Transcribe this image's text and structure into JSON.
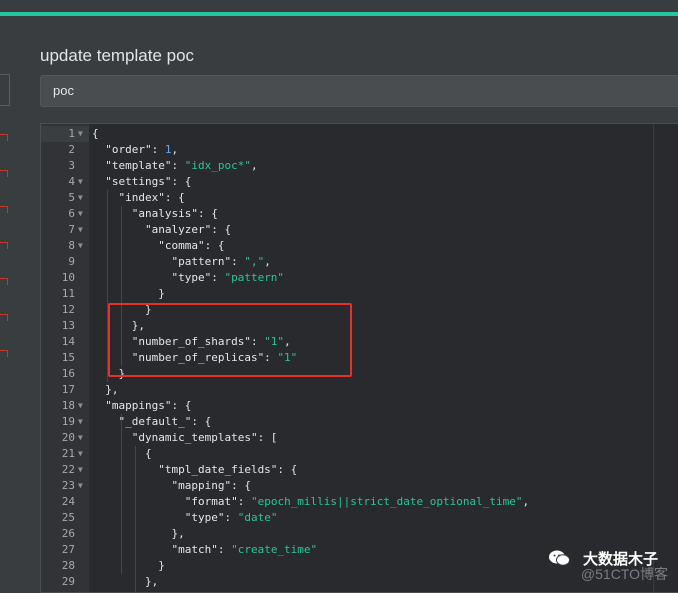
{
  "page": {
    "title": "update template poc",
    "name_field_value": "poc"
  },
  "editor": {
    "lines": [
      {
        "n": "1",
        "fold": true,
        "parts": [
          {
            "t": "{",
            "c": "k"
          }
        ]
      },
      {
        "n": "2",
        "fold": false,
        "parts": [
          {
            "t": "  \"order\": ",
            "c": "k"
          },
          {
            "t": "1",
            "c": "n"
          },
          {
            "t": ",",
            "c": "k"
          }
        ]
      },
      {
        "n": "3",
        "fold": false,
        "parts": [
          {
            "t": "  \"template\": ",
            "c": "k"
          },
          {
            "t": "\"idx_poc*\"",
            "c": "s"
          },
          {
            "t": ",",
            "c": "k"
          }
        ]
      },
      {
        "n": "4",
        "fold": true,
        "parts": [
          {
            "t": "  \"settings\": {",
            "c": "k"
          }
        ]
      },
      {
        "n": "5",
        "fold": true,
        "parts": [
          {
            "t": "    \"index\": {",
            "c": "k"
          }
        ]
      },
      {
        "n": "6",
        "fold": true,
        "parts": [
          {
            "t": "      \"analysis\": {",
            "c": "k"
          }
        ]
      },
      {
        "n": "7",
        "fold": true,
        "parts": [
          {
            "t": "        \"analyzer\": {",
            "c": "k"
          }
        ]
      },
      {
        "n": "8",
        "fold": true,
        "parts": [
          {
            "t": "          \"comma\": {",
            "c": "k"
          }
        ]
      },
      {
        "n": "9",
        "fold": false,
        "parts": [
          {
            "t": "            \"pattern\": ",
            "c": "k"
          },
          {
            "t": "\",\"",
            "c": "s"
          },
          {
            "t": ",",
            "c": "k"
          }
        ]
      },
      {
        "n": "10",
        "fold": false,
        "parts": [
          {
            "t": "            \"type\": ",
            "c": "k"
          },
          {
            "t": "\"pattern\"",
            "c": "s"
          }
        ]
      },
      {
        "n": "11",
        "fold": false,
        "parts": [
          {
            "t": "          }",
            "c": "k"
          }
        ]
      },
      {
        "n": "12",
        "fold": false,
        "parts": [
          {
            "t": "        }",
            "c": "k"
          }
        ]
      },
      {
        "n": "13",
        "fold": false,
        "parts": [
          {
            "t": "      },",
            "c": "k"
          }
        ]
      },
      {
        "n": "14",
        "fold": false,
        "parts": [
          {
            "t": "      \"number_of_shards\": ",
            "c": "k"
          },
          {
            "t": "\"1\"",
            "c": "s"
          },
          {
            "t": ",",
            "c": "k"
          }
        ]
      },
      {
        "n": "15",
        "fold": false,
        "parts": [
          {
            "t": "      \"number_of_replicas\": ",
            "c": "k"
          },
          {
            "t": "\"1\"",
            "c": "s"
          }
        ]
      },
      {
        "n": "16",
        "fold": false,
        "parts": [
          {
            "t": "    }",
            "c": "k"
          }
        ]
      },
      {
        "n": "17",
        "fold": false,
        "parts": [
          {
            "t": "  },",
            "c": "k"
          }
        ]
      },
      {
        "n": "18",
        "fold": true,
        "parts": [
          {
            "t": "  \"mappings\": {",
            "c": "k"
          }
        ]
      },
      {
        "n": "19",
        "fold": true,
        "parts": [
          {
            "t": "    \"_default_\": {",
            "c": "k"
          }
        ]
      },
      {
        "n": "20",
        "fold": true,
        "parts": [
          {
            "t": "      \"dynamic_templates\": [",
            "c": "k"
          }
        ]
      },
      {
        "n": "21",
        "fold": true,
        "parts": [
          {
            "t": "        {",
            "c": "k"
          }
        ]
      },
      {
        "n": "22",
        "fold": true,
        "parts": [
          {
            "t": "          \"tmpl_date_fields\": {",
            "c": "k"
          }
        ]
      },
      {
        "n": "23",
        "fold": true,
        "parts": [
          {
            "t": "            \"mapping\": {",
            "c": "k"
          }
        ]
      },
      {
        "n": "24",
        "fold": false,
        "parts": [
          {
            "t": "              \"format\": ",
            "c": "k"
          },
          {
            "t": "\"epoch_millis||strict_date_optional_time\"",
            "c": "s"
          },
          {
            "t": ",",
            "c": "k"
          }
        ]
      },
      {
        "n": "25",
        "fold": false,
        "parts": [
          {
            "t": "              \"type\": ",
            "c": "k"
          },
          {
            "t": "\"date\"",
            "c": "s"
          }
        ]
      },
      {
        "n": "26",
        "fold": false,
        "parts": [
          {
            "t": "            },",
            "c": "k"
          }
        ]
      },
      {
        "n": "27",
        "fold": false,
        "parts": [
          {
            "t": "            \"match\": ",
            "c": "k"
          },
          {
            "t": "\"create_time\"",
            "c": "s"
          }
        ]
      },
      {
        "n": "28",
        "fold": false,
        "parts": [
          {
            "t": "          }",
            "c": "k"
          }
        ]
      },
      {
        "n": "29",
        "fold": false,
        "parts": [
          {
            "t": "        },",
            "c": "k"
          }
        ]
      }
    ]
  },
  "watermark": {
    "brand": "大数据木子",
    "sub": "@51CTO博客",
    "icon": "wechat-icon"
  },
  "colors": {
    "accent": "#26c6a0",
    "highlight": "#e8302a",
    "string": "#28c59b",
    "number": "#6aa7e8"
  }
}
